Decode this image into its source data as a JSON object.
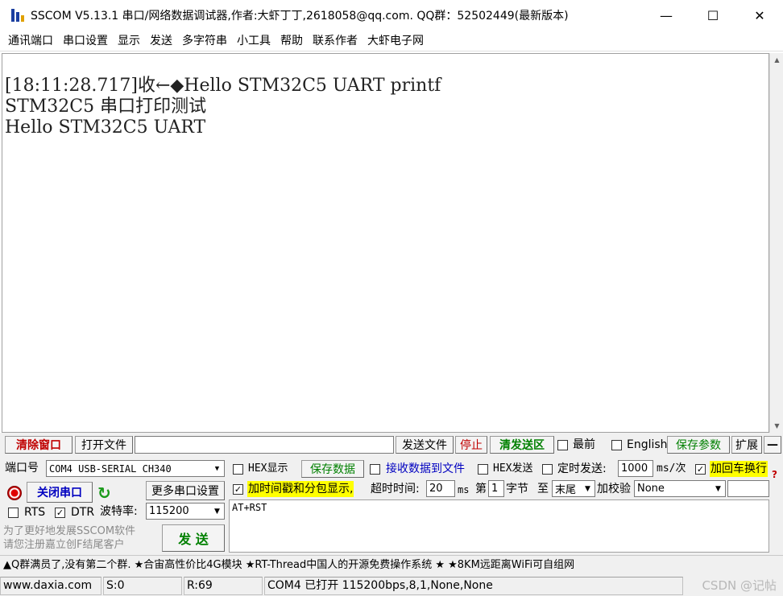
{
  "window": {
    "title": "SSCOM V5.13.1 串口/网络数据调试器,作者:大虾丁丁,2618058@qq.com. QQ群：52502449(最新版本)",
    "minimize": "—",
    "maximize": "☐",
    "close": "✕"
  },
  "menu": [
    "通讯端口",
    "串口设置",
    "显示",
    "发送",
    "多字符串",
    "小工具",
    "帮助",
    "联系作者",
    "大虾电子网"
  ],
  "receive": {
    "lines": [
      "[18:11:28.717]收←◆Hello STM32C5 UART printf",
      "STM32C5 串口打印测试",
      "Hello STM32C5 UART"
    ]
  },
  "toolbar": {
    "clear_window": "清除窗口",
    "open_file": "打开文件",
    "file_path": "",
    "send_file": "发送文件",
    "stop": "停止",
    "clear_send": "清发送区",
    "topmost": "最前",
    "english": "English",
    "save_params": "保存参数",
    "expand": "扩展",
    "collapse": "—"
  },
  "port": {
    "port_label": "端口号",
    "port_value": "COM4 USB-SERIAL CH340",
    "close_port": "关闭串口",
    "more_settings": "更多串口设置",
    "rts_label": "RTS",
    "rts_checked": false,
    "dtr_label": "DTR",
    "dtr_checked": true,
    "baud_label": "波特率:",
    "baud_value": "115200"
  },
  "options": {
    "hex_display": "HEX显示",
    "hex_display_checked": false,
    "save_data": "保存数据",
    "recv_to_file": "接收数据到文件",
    "recv_to_file_checked": false,
    "hex_send": "HEX发送",
    "hex_send_checked": false,
    "timed_send": "定时发送:",
    "timed_send_checked": false,
    "interval_value": "1000",
    "interval_unit": "ms/次",
    "add_crlf": "加回车换行",
    "add_crlf_checked": true,
    "timestamp": "加时间戳和分包显示,",
    "timestamp_checked": true,
    "timeout_label": "超时时间:",
    "timeout_value": "20",
    "timeout_unit": "ms",
    "byte_label_1": "第",
    "byte_value": "1",
    "byte_label_2": "字节",
    "to_label": "至",
    "to_value": "末尾",
    "checksum_label": "加校验",
    "checksum_value": "None"
  },
  "send": {
    "promo_line_1": "为了更好地发展SSCOM软件",
    "promo_line_2": "请您注册嘉立创F结尾客户",
    "send_button": "发 送",
    "send_text": "AT+RST"
  },
  "ticker": "▲Q群满员了,没有第二个群. ★合宙高性价比4G模块 ★RT-Thread中国人的开源免费操作系统 ★ ★8KM远距离WiFi可自组网",
  "status": {
    "website": "www.daxia.com",
    "sent": "S:0",
    "received": "R:69",
    "port_status": "COM4 已打开  115200bps,8,1,None,None"
  },
  "watermark": "CSDN @记帖"
}
